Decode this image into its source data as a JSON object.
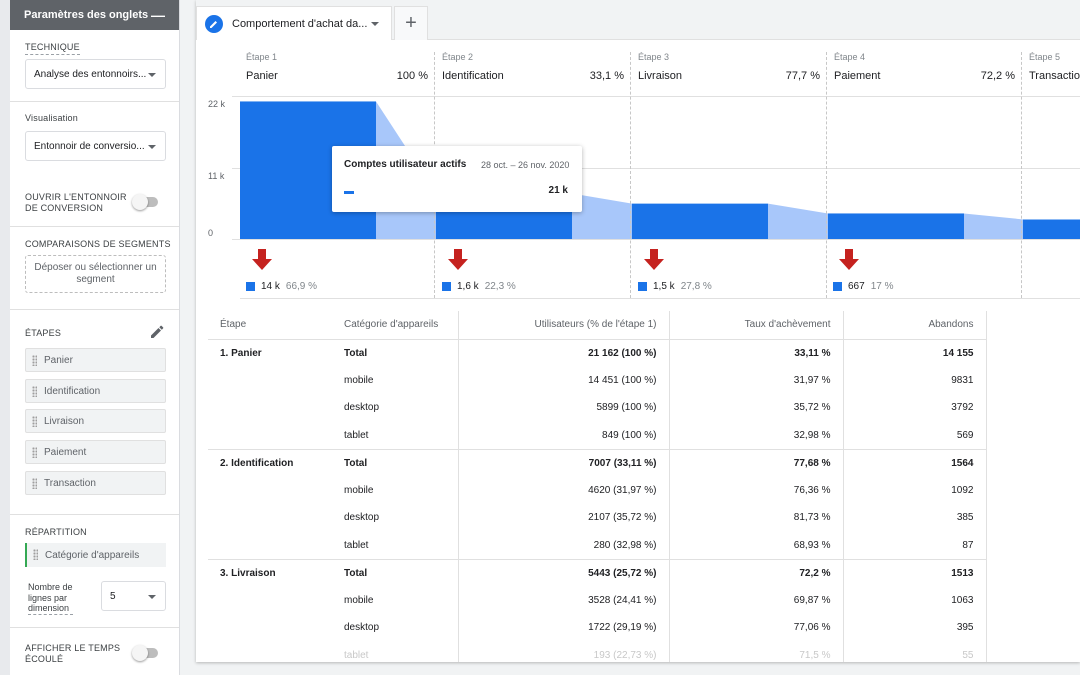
{
  "sidebar": {
    "header_title": "Paramètres des onglets",
    "technique_label": "TECHNIQUE",
    "technique_value": "Analyse des entonnoirs...",
    "visualisation_label": "Visualisation",
    "visualisation_value": "Entonnoir de conversio...",
    "open_funnel_label_1": "OUVRIR L'ENTONNOIR",
    "open_funnel_label_2": "DE CONVERSION",
    "segments_label": "COMPARAISONS DE SEGMENTS",
    "segments_drop": "Déposer ou sélectionner un segment",
    "steps_label": "ÉTAPES",
    "steps": [
      "Panier",
      "Identification",
      "Livraison",
      "Paiement",
      "Transaction"
    ],
    "repartition_label": "RÉPARTITION",
    "repartition_value": "Catégorie d'appareils",
    "rows_label_1": "Nombre de",
    "rows_label_2": "lignes par",
    "rows_label_3": "dimension",
    "rows_value": "5",
    "elapsed_label_1": "AFFICHER LE TEMPS",
    "elapsed_label_2": "ÉCOULÉ"
  },
  "tabs": {
    "active_label": "Comportement d'achat da...",
    "add_label": "+"
  },
  "funnel": {
    "steps": [
      {
        "head": "Étape 1",
        "name": "Panier",
        "pct": "100 %"
      },
      {
        "head": "Étape 2",
        "name": "Identification",
        "pct": "33,1 %"
      },
      {
        "head": "Étape 3",
        "name": "Livraison",
        "pct": "77,7 %"
      },
      {
        "head": "Étape 4",
        "name": "Paiement",
        "pct": "72,2 %"
      },
      {
        "head": "Étape 5",
        "name": "Transaction",
        "pct": ""
      }
    ],
    "yticks": [
      "22 k",
      "11 k",
      "0"
    ],
    "ymax": 22000,
    "bar_values": [
      21162,
      7007,
      5443,
      3930,
      3000
    ],
    "abandons": [
      {
        "count": "14 k",
        "pct": "66,9 %"
      },
      {
        "count": "1,6 k",
        "pct": "22,3 %"
      },
      {
        "count": "1,5 k",
        "pct": "27,8 %"
      },
      {
        "count": "667",
        "pct": "17 %"
      }
    ],
    "colors": {
      "bar": "#1a73e8",
      "flow": "#a8c7fa",
      "arrow": "#c5221f"
    },
    "tooltip": {
      "title": "Comptes utilisateur actifs",
      "date": "28 oct. – 26 nov. 2020",
      "value": "21 k"
    }
  },
  "table": {
    "headers": [
      "Étape",
      "Catégorie d'appareils",
      "Utilisateurs (% de l'étape 1)",
      "Taux d'achèvement",
      "Abandons"
    ],
    "groups": [
      {
        "step": "1. Panier",
        "rows": [
          [
            "Total",
            "21 162 (100 %)",
            "33,11 %",
            "14 155"
          ],
          [
            "mobile",
            "14 451 (100 %)",
            "31,97 %",
            "9831"
          ],
          [
            "desktop",
            "5899 (100 %)",
            "35,72 %",
            "3792"
          ],
          [
            "tablet",
            "849 (100 %)",
            "32,98 %",
            "569"
          ]
        ]
      },
      {
        "step": "2. Identification",
        "rows": [
          [
            "Total",
            "7007 (33,11 %)",
            "77,68 %",
            "1564"
          ],
          [
            "mobile",
            "4620 (31,97 %)",
            "76,36 %",
            "1092"
          ],
          [
            "desktop",
            "2107 (35,72 %)",
            "81,73 %",
            "385"
          ],
          [
            "tablet",
            "280 (32,98 %)",
            "68,93 %",
            "87"
          ]
        ]
      },
      {
        "step": "3. Livraison",
        "rows": [
          [
            "Total",
            "5443 (25,72 %)",
            "72,2 %",
            "1513"
          ],
          [
            "mobile",
            "3528 (24,41 %)",
            "69,87 %",
            "1063"
          ],
          [
            "desktop",
            "1722 (29,19 %)",
            "77,06 %",
            "395"
          ],
          [
            "tablet",
            "193 (22,73 %)",
            "71,5 %",
            "55"
          ]
        ]
      }
    ]
  }
}
